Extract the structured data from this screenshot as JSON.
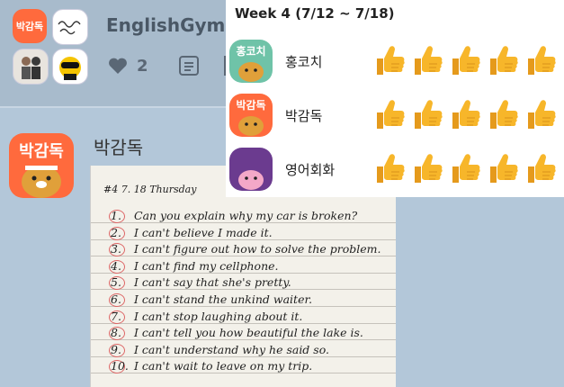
{
  "header": {
    "app_title": "EnglishGym",
    "avatar_label": "박감독",
    "like_count": "2"
  },
  "post": {
    "author": "박감독",
    "avatar_label": "박감독"
  },
  "notebook": {
    "heading": "#4 7. 18 Thursday",
    "items": [
      {
        "num": "1.",
        "text": "Can you explain why my car is broken?"
      },
      {
        "num": "2.",
        "text": "I can't believe I made it."
      },
      {
        "num": "3.",
        "text": "I can't figure out how to solve the problem."
      },
      {
        "num": "4.",
        "text": "I can't find my cellphone."
      },
      {
        "num": "5.",
        "text": "I can't say that she's pretty."
      },
      {
        "num": "6.",
        "text": "I can't stand the unkind waiter."
      },
      {
        "num": "7.",
        "text": "I can't stop laughing about it."
      },
      {
        "num": "8.",
        "text": "I can't tell you how beautiful the lake is."
      },
      {
        "num": "9.",
        "text": "I can't understand why he said so."
      },
      {
        "num": "10.",
        "text": "I can't wait to leave on my trip."
      }
    ]
  },
  "week": {
    "title": "Week 4 (7/12 ~ 7/18)",
    "members": [
      {
        "name": "홍코치",
        "avatar_label": "홍코치",
        "thumbs": 5
      },
      {
        "name": "박감독",
        "avatar_label": "박감독",
        "thumbs": 5
      },
      {
        "name": "영어회화",
        "avatar_label": "",
        "thumbs": 5
      }
    ]
  },
  "colors": {
    "background": "#b3c7d9",
    "header": "#a8bbcc",
    "accent_orange": "#ff6a3d",
    "thumb_yellow": "#f7b62a"
  },
  "icons": [
    "heart-icon",
    "memo-icon",
    "thumbs-up-icon"
  ]
}
